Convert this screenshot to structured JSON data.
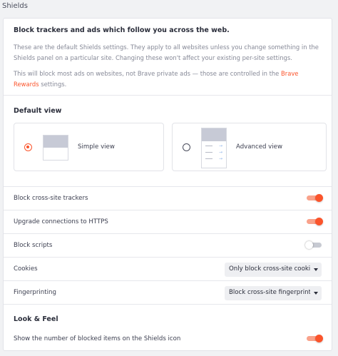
{
  "page": {
    "title": "Shields"
  },
  "intro": {
    "heading": "Block trackers and ads which follow you across the web.",
    "paragraph1": "These are the default Shields settings. They apply to all websites unless you change something in the Shields panel on a particular site. Changing these won't affect your existing per-site settings.",
    "paragraph2_before": "This will block most ads on websites, not Brave private ads — those are controlled in the ",
    "paragraph2_link": "Brave Rewards",
    "paragraph2_after": " settings."
  },
  "default_view": {
    "heading": "Default view",
    "options": [
      {
        "label": "Simple view",
        "selected": true
      },
      {
        "label": "Advanced view",
        "selected": false
      }
    ]
  },
  "settings": [
    {
      "label": "Block cross-site trackers",
      "type": "toggle",
      "on": true
    },
    {
      "label": "Upgrade connections to HTTPS",
      "type": "toggle",
      "on": true
    },
    {
      "label": "Block scripts",
      "type": "toggle",
      "on": false
    },
    {
      "label": "Cookies",
      "type": "select",
      "value": "Only block cross-site cookies"
    },
    {
      "label": "Fingerprinting",
      "type": "select",
      "value": "Block cross-site fingerprintin"
    }
  ],
  "look_and_feel": {
    "heading": "Look & Feel",
    "settings": [
      {
        "label": "Show the number of blocked items on the Shields icon",
        "type": "toggle",
        "on": true
      }
    ]
  },
  "colors": {
    "accent": "#fb542b",
    "toggle_track_on": "#f9a28b",
    "toggle_track_off": "#c7cad2"
  }
}
